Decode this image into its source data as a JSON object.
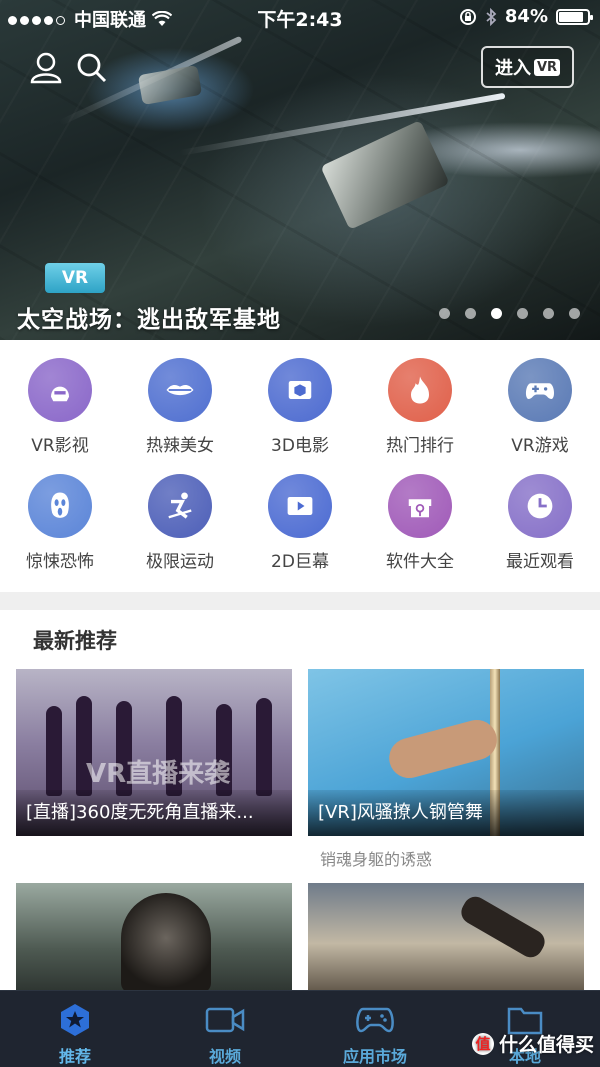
{
  "status_bar": {
    "carrier": "中国联通",
    "time": "下午2:43",
    "battery_percent": "84%",
    "battery_level": 0.84,
    "signal_dots": 5,
    "signal_filled": 4
  },
  "hero": {
    "enter_vr_label": "进入",
    "enter_vr_tag": "VR",
    "badge": "VR",
    "title": "太空战场：逃出敌军基地",
    "page_count": 6,
    "active_page": 3
  },
  "categories": [
    {
      "label": "VR影视",
      "icon": "helmet-icon",
      "color": "#8a67c9"
    },
    {
      "label": "热辣美女",
      "icon": "lips-icon",
      "color": "#4f6fd0"
    },
    {
      "label": "3D电影",
      "icon": "3d-cube-icon",
      "color": "#4d6bd0"
    },
    {
      "label": "热门排行",
      "icon": "flame-icon",
      "color": "#e0604a"
    },
    {
      "label": "VR游戏",
      "icon": "gamepad-icon",
      "color": "#5a7ab5"
    },
    {
      "label": "惊悚恐怖",
      "icon": "scream-mask-icon",
      "color": "#5b85d8"
    },
    {
      "label": "极限运动",
      "icon": "skier-icon",
      "color": "#4d5fb8"
    },
    {
      "label": "2D巨幕",
      "icon": "play-screen-icon",
      "color": "#4c6bd2"
    },
    {
      "label": "软件大全",
      "icon": "gift-icon",
      "color": "#a05ab8"
    },
    {
      "label": "最近观看",
      "icon": "clock-icon",
      "color": "#8670c8"
    }
  ],
  "recommend": {
    "section_title": "最新推荐",
    "cards": [
      {
        "caption": "[直播]360度无死角直播来...",
        "overlay": "VR直播来袭"
      },
      {
        "caption": "[VR]风骚撩人钢管舞",
        "subtitle": "销魂身躯的诱惑"
      }
    ]
  },
  "tabbar": {
    "tabs": [
      {
        "label": "推荐",
        "icon": "star-hexagon-icon"
      },
      {
        "label": "视频",
        "icon": "video-camera-icon"
      },
      {
        "label": "应用市场",
        "icon": "gamepad-icon"
      },
      {
        "label": "本地",
        "icon": "folder-icon"
      }
    ]
  },
  "watermark": {
    "logo": "值",
    "text": "什么值得买"
  }
}
